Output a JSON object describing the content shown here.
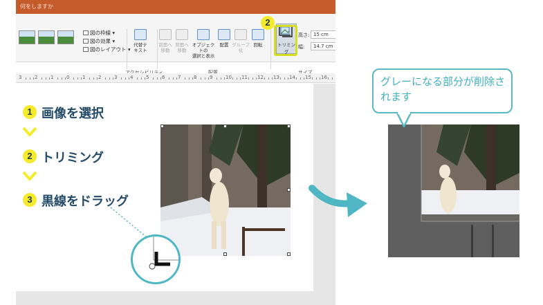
{
  "ribbon": {
    "tell_me": "何をしますか",
    "picture_options": [
      "図の枠線",
      "図の効果",
      "図のレイアウト"
    ],
    "alt_text": [
      "代替テ",
      "キスト"
    ],
    "group_accessibility": "アクセシビリティ",
    "arrange_buttons": [
      {
        "line1": "前面へ",
        "line2": "移動"
      },
      {
        "line1": "背面へ",
        "line2": "移動"
      },
      {
        "line1": "オブジェクトの",
        "line2": "選択と表示"
      },
      {
        "line1": "配置",
        "line2": ""
      },
      {
        "line1": "グループ化",
        "line2": ""
      },
      {
        "line1": "回転",
        "line2": ""
      }
    ],
    "group_arrange": "配置",
    "trim_label": "トリミング",
    "height_label": "高さ:",
    "height_value": "15 cm",
    "width_label": "幅:",
    "width_value": "14.7 cm",
    "group_size": "サイズ"
  },
  "ruler": [
    "3",
    "2",
    "1",
    "0",
    "1",
    "2",
    "3",
    "4",
    "5",
    "6",
    "7",
    "8",
    "9",
    "10",
    "11",
    "12",
    "13",
    "14",
    "15",
    "16"
  ],
  "steps": [
    {
      "num": "1",
      "text": "画像を選択"
    },
    {
      "num": "2",
      "text": "トリミング"
    },
    {
      "num": "3",
      "text": "黒線をドラッグ"
    }
  ],
  "ribbon_step_num": "2",
  "callout": "グレーになる部分が削除されます",
  "colors": {
    "accent_teal": "#4fb6c3",
    "badge_yellow": "#f6ea2c",
    "step_text": "#234a66",
    "titlebar": "#c55a2b"
  }
}
